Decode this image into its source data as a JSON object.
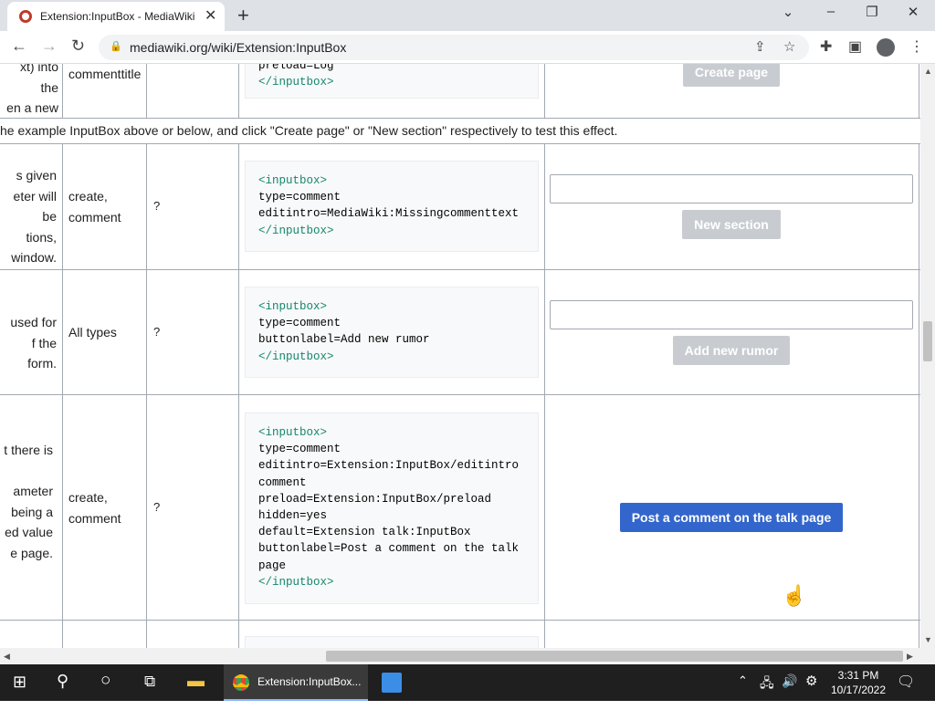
{
  "browser": {
    "tab_title": "Extension:InputBox - MediaWiki",
    "url": "mediawiki.org/wiki/Extension:InputBox"
  },
  "table": {
    "top_row": {
      "desc_lines": [
        "xt) into the",
        "en a new"
      ],
      "param": "commenttitle",
      "code_lines": [
        "preload=Log",
        "</inputbox>"
      ],
      "button": "Create page"
    },
    "note": "he example InputBox above or below, and click \"Create page\" or \"New section\" respectively to test this effect.",
    "row1": {
      "desc_lines": [
        "s given",
        "eter will be",
        "tions,",
        "window."
      ],
      "types": [
        "create,",
        "comment"
      ],
      "default": "?",
      "code_lines": [
        "type=comment",
        "editintro=MediaWiki:Missingcommenttext"
      ],
      "button": "New section"
    },
    "row2": {
      "desc_lines": [
        "used for",
        "f the form."
      ],
      "types": [
        "All types"
      ],
      "default": "?",
      "code_lines": [
        "type=comment",
        "buttonlabel=Add new rumor"
      ],
      "button": "Add new rumor"
    },
    "row3": {
      "desc_lines": [
        "t there is",
        "",
        "ameter",
        "being a",
        "ed value",
        "e page."
      ],
      "types": [
        "create,",
        "comment"
      ],
      "default": "?",
      "code_lines": [
        "type=comment",
        "editintro=Extension:InputBox/editintro",
        "comment",
        "preload=Extension:InputBox/preload",
        "hidden=yes",
        "default=Extension talk:InputBox",
        "buttonlabel=Post a comment on the talk",
        "page"
      ],
      "button": "Post a comment on the talk page"
    },
    "tag_open": "<inputbox>",
    "tag_close": "</inputbox>"
  },
  "taskbar": {
    "chrome_label": "Extension:InputBox...",
    "time": "3:31 PM",
    "date": "10/17/2022"
  },
  "colors": {
    "primary_button": "#3366cc",
    "disabled_button": "#c8ccd1",
    "code_tag": "#14866d"
  }
}
